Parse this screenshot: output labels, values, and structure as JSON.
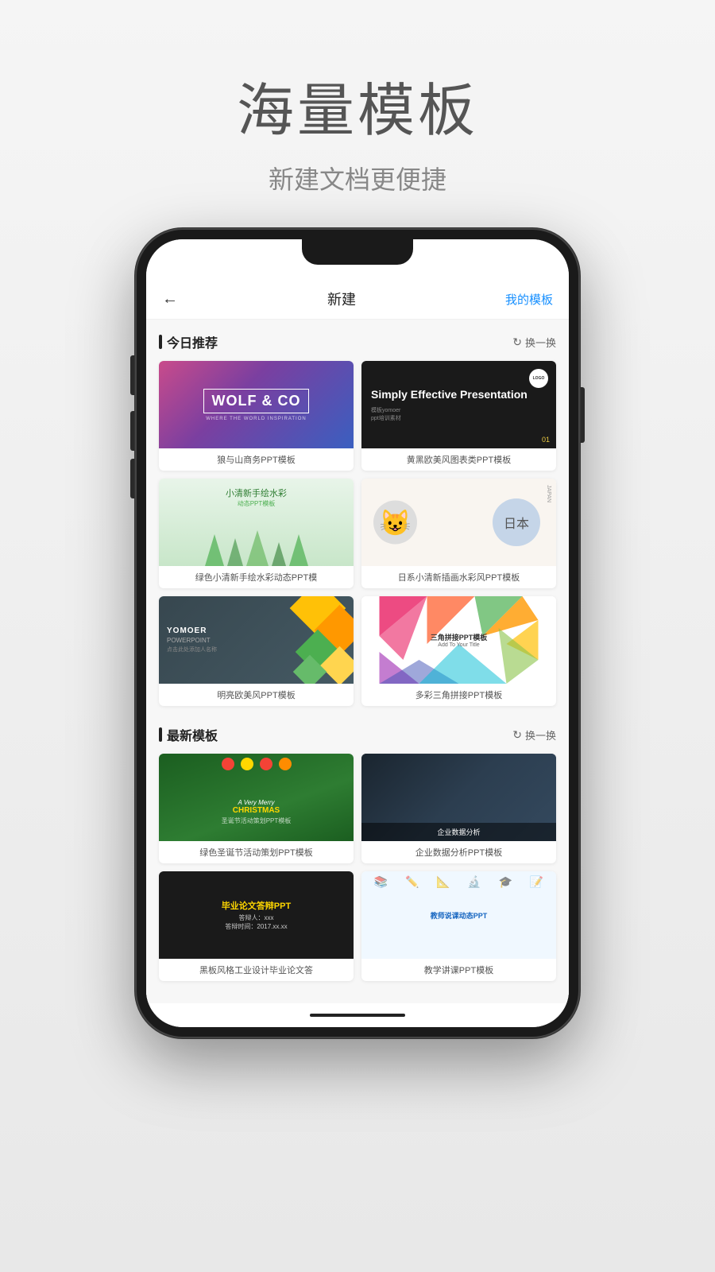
{
  "page": {
    "title": "海量模板",
    "subtitle": "新建文档更便捷"
  },
  "nav": {
    "back_icon": "←",
    "title": "新建",
    "action": "我的模板"
  },
  "sections": {
    "today": {
      "label": "今日推荐",
      "action": "换一换"
    },
    "latest": {
      "label": "最新模板",
      "action": "换一换"
    }
  },
  "today_templates": [
    {
      "id": "wolf",
      "title": "WOLF & CO",
      "subtitle": "WHERE THE WORLD INSPIRATION",
      "label": "狼与山商务PPT模板"
    },
    {
      "id": "simply",
      "title": "Simply Effective Presentation",
      "logo": "LOGO",
      "num": "01",
      "label": "黄黑欧美风图表类PPT模板"
    },
    {
      "id": "watercolor",
      "title": "小清新手绘水彩",
      "subtitle": "动态PPT模板",
      "label": "绿色小清新手绘水彩动态PPT模"
    },
    {
      "id": "japan",
      "title": "日本",
      "subtitle": "JAPAN",
      "label": "日系小清新插画水彩风PPT模板"
    },
    {
      "id": "yomoer",
      "brand": "YOMOER",
      "product": "POWERPOINT",
      "desc": "点击此处添加人名称",
      "label": "明亮欧美风PPT模板"
    },
    {
      "id": "triangle",
      "title": "三角拼接PPT模板",
      "subtitle": "Add To Your Title",
      "label": "多彩三角拼接PPT模板"
    }
  ],
  "latest_templates": [
    {
      "id": "christmas",
      "very_merry": "A Very Merry",
      "title": "CHRISTMAS",
      "subtitle": "圣诞节活动策划PPT模板",
      "label": "绿色圣诞节活动策划PPT模板"
    },
    {
      "id": "business",
      "title": "企业数据分析",
      "label": "企业数据分析PPT模板"
    },
    {
      "id": "graduation",
      "title": "毕业论文答辩PPT",
      "label": "黑板风格工业设计毕业论文答"
    },
    {
      "id": "teacher",
      "title": "教师说课动态PPT",
      "label": "教学讲课PPT模板"
    }
  ]
}
